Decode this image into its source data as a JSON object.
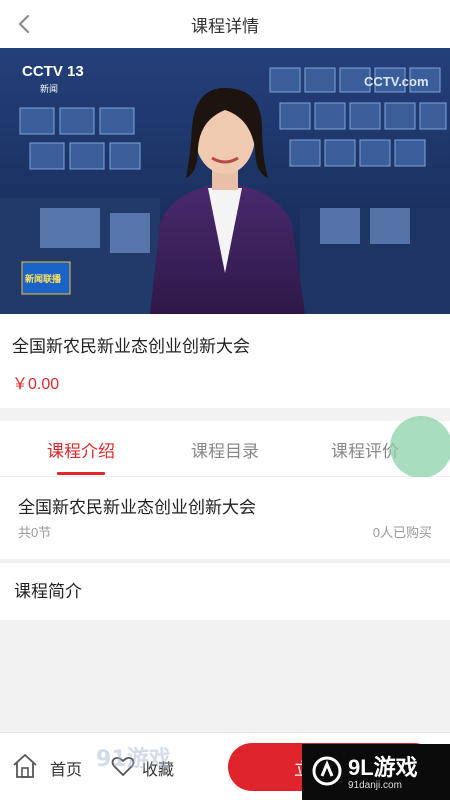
{
  "header": {
    "title": "课程详情"
  },
  "video": {
    "channel_logo": "CCTV 13",
    "channel_sub": "新闻",
    "corner_logo": "CCTV.com",
    "program_logo": "新闻联播"
  },
  "course": {
    "title": "全国新农民新业态创业创新大会",
    "price": "￥0.00"
  },
  "tabs": [
    {
      "label": "课程介绍",
      "active": true
    },
    {
      "label": "课程目录",
      "active": false
    },
    {
      "label": "课程评价",
      "active": false
    }
  ],
  "intro": {
    "title": "全国新农民新业态创业创新大会",
    "lessons": "共0节",
    "buyers": "0人已购买",
    "heading": "课程简介"
  },
  "bottom": {
    "home_label": "首页",
    "favorite_label": "收藏",
    "buy_label": "立"
  },
  "watermark": {
    "left_text": "91游戏",
    "right_big": "9L游戏",
    "right_small": "91danji.com"
  },
  "colors": {
    "accent": "#e0292d",
    "video_bg": "#1a2d55"
  }
}
